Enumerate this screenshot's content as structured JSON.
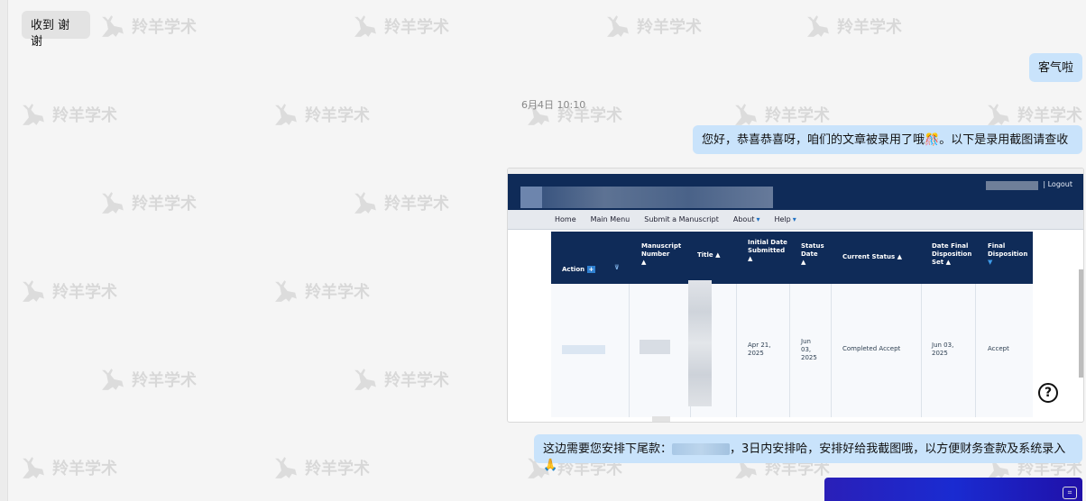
{
  "brand": {
    "watermark_text": "羚羊学术",
    "accent": "#c9e3fb"
  },
  "messages": {
    "m1": "收到 谢谢",
    "m2": "客气啦",
    "timestamp": "6月4日 10:10",
    "m3": "您好，恭喜恭喜呀，咱们的文章被录用了哦",
    "m3_emoji": "🎊",
    "m3_tail": "。以下是录用截图请查收",
    "m4_prefix": "这边需要您安排下尾款：",
    "m4_suffix": "，3日内安排哈，安排好给我截图哦，以方便财务查款及系统录入",
    "m4_emoji": "🙏"
  },
  "screenshot": {
    "logout": "Logout",
    "nav": [
      "Home",
      "Main Menu",
      "Submit a Manuscript",
      "About",
      "Help"
    ],
    "columns": {
      "action": "Action",
      "manuscript": "Manuscript Number",
      "title": "Title",
      "initial": "Initial Date Submitted",
      "status_date": "Status Date",
      "current": "Current Status",
      "final_date": "Date Final Disposition Set",
      "final": "Final Disposition"
    },
    "row": {
      "initial": "Apr 21, 2025",
      "status_date": "Jun 03, 2025",
      "current": "Completed Accept",
      "final_date": "Jun 03, 2025",
      "final": "Accept"
    },
    "help_label": "?"
  }
}
